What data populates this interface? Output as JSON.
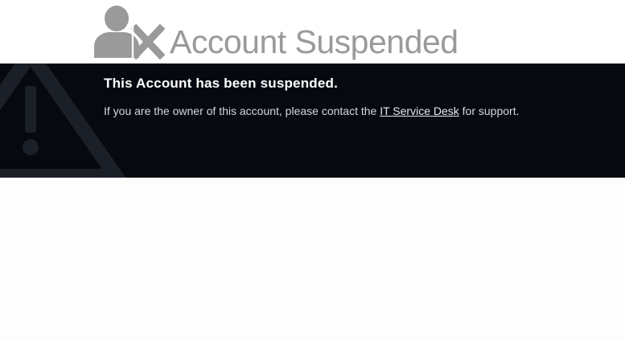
{
  "header": {
    "title": "Account Suspended",
    "icon": "user-suspended-icon"
  },
  "banner": {
    "heading": "This Account has been suspended.",
    "message_before": "If you are the owner of this account, please contact the ",
    "link_text": "IT Service Desk",
    "message_after": " for support.",
    "background_icon": "warning-triangle-icon"
  },
  "colors": {
    "banner_background": "#060a10",
    "logo_gray": "#9a9a9a",
    "heading_text": "#ffffff",
    "body_text": "#d4d6da"
  }
}
